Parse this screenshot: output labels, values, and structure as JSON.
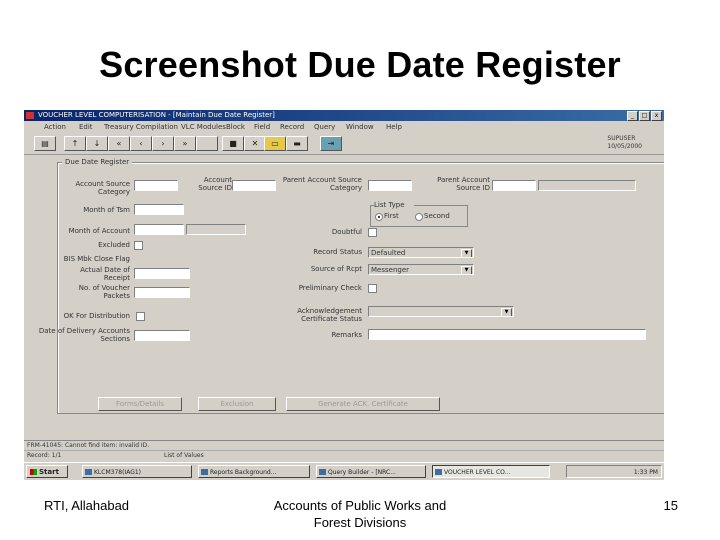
{
  "slide": {
    "title": "Screenshot Due Date Register",
    "footer_left": "RTI, Allahabad",
    "footer_center_line1": "Accounts of Public Works and",
    "footer_center_line2": "Forest Divisions",
    "page_number": "15"
  },
  "window": {
    "title": "VOUCHER LEVEL COMPUTERISATION - [Maintain Due Date Register]",
    "controls": [
      "_",
      "□",
      "x"
    ]
  },
  "menu": [
    "Action",
    "Edit",
    "Treasury Compilation",
    "VLC Modules",
    "Block",
    "Field",
    "Record",
    "Query",
    "Window",
    "Help"
  ],
  "toolbar": {
    "user_line1": "SUPUSER",
    "user_line2": "10/05/2000"
  },
  "form": {
    "frame_title": "Due Date Register",
    "labels": {
      "account_source_category": "Account Source Category",
      "account_source_id": "Account Source ID",
      "parent_account_source_category": "Parent Account Source Category",
      "parent_account_source_id": "Parent Account Source ID",
      "month_of_tsm": "Month of Tsm",
      "list_type": "List Type",
      "first": "First",
      "second": "Second",
      "month_of_account": "Month of Account",
      "doubtful": "Doubtful",
      "excluded": "Excluded",
      "record_status": "Record Status",
      "bis_mbk_close_flag": "BIS Mbk Close Flag",
      "actual_date_of_receipt": "Actual Date of Receipt",
      "source_of_rcpt": "Source of Rcpt",
      "no_of_voucher_packets": "No. of Voucher Packets",
      "preliminary_check": "Preliminary Check",
      "ok_for_distribution": "OK For Distribution",
      "acknowledgement_certificate_status": "Acknowledgement Certificate Status",
      "date_of_delivery_accounts_sections": "Date of Delivery Accounts Sections",
      "remarks": "Remarks"
    },
    "values": {
      "record_status": "Defaulted",
      "source_of_rcpt": "Messenger"
    },
    "buttons": {
      "forms_details": "Forms/Details",
      "exclusion": "Exclusion",
      "generate_ack_certificate": "Generate ACK. Certificate"
    }
  },
  "status": {
    "message": "FRM-41045: Cannot find item: invalid ID.",
    "record": "Record: 1/1",
    "list_of_values": "List of Values"
  },
  "taskbar": {
    "start": "Start",
    "tasks": [
      "KLCM378(IAG1)",
      "Reports Background...",
      "Query Builder - [NRC...",
      "VOUCHER LEVEL CO..."
    ],
    "clock": "1:33 PM"
  }
}
